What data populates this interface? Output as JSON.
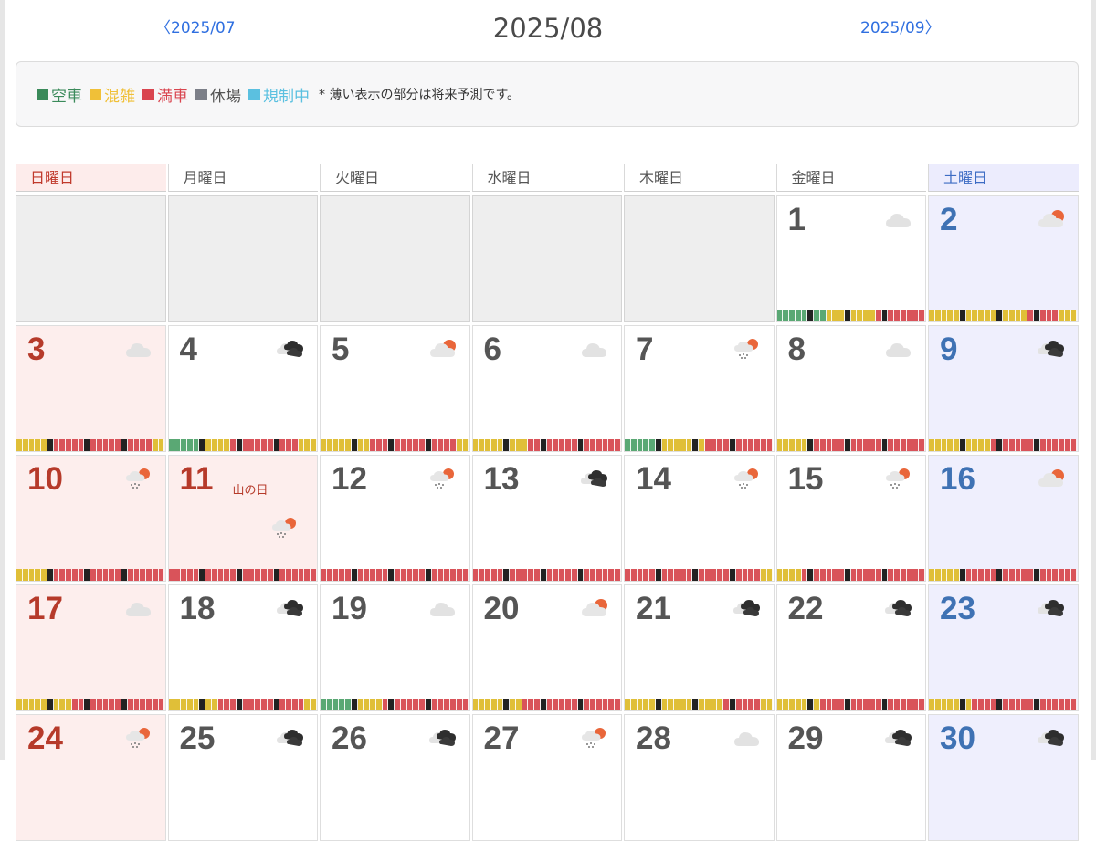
{
  "nav": {
    "prev": "〈2025/07",
    "title": "2025/08",
    "next": "2025/09〉"
  },
  "legend": {
    "items": [
      {
        "label": "空車",
        "color": "#3a8a5a"
      },
      {
        "label": "混雑",
        "color": "#f0c038"
      },
      {
        "label": "満車",
        "color": "#d9454f"
      },
      {
        "label": "休場",
        "color": "#7c7f88"
      },
      {
        "label": "規制中",
        "color": "#5bc0e0"
      }
    ],
    "note": "* 薄い表示の部分は将来予測です。"
  },
  "weekdays": [
    "日曜日",
    "月曜日",
    "火曜日",
    "水曜日",
    "木曜日",
    "金曜日",
    "土曜日"
  ],
  "colors": {
    "empty": "#5aa874",
    "crowded": "#e0bf38",
    "full": "#d9535a",
    "sunday": "#b63a2a",
    "saturday": "#3f72b4"
  },
  "days": [
    {
      "day": "1",
      "col": 5,
      "weather": "cloud",
      "pattern": "GGGGGGGGYYYYYYYYRRRRRRRR"
    },
    {
      "day": "2",
      "col": 6,
      "weather": "sun-cloud",
      "pattern": "YYYYYYYYYYYYYYYYRRRRRYYY"
    },
    {
      "day": "3",
      "col": 0,
      "weather": "cloud",
      "pattern": "YYYYYRRRRRRRRRRRRRRRRRYY"
    },
    {
      "day": "4",
      "col": 1,
      "weather": "dark-cloud",
      "pattern": "GGGGGYYYYYRRRRRRRRRRRYYY"
    },
    {
      "day": "5",
      "col": 2,
      "weather": "sun-cloud",
      "pattern": "YYYYYYYYRRRRRRRRRRRRRRYY"
    },
    {
      "day": "6",
      "col": 3,
      "weather": "cloud",
      "pattern": "YYYYYYYYYRRRRRRRRRRRRRRR"
    },
    {
      "day": "7",
      "col": 4,
      "weather": "rain-sun",
      "pattern": "GGGGGGYYYYYYYRRRRRRRRRRR"
    },
    {
      "day": "8",
      "col": 5,
      "weather": "cloud",
      "pattern": "YYYYYYRRRRRRRRRRRRRRRRRR"
    },
    {
      "day": "9",
      "col": 6,
      "weather": "dark-cloud",
      "pattern": "YYYYYYYYYYRRRRRRRRRRRRRR"
    },
    {
      "day": "10",
      "col": 0,
      "weather": "rain-sun",
      "pattern": "YYYYYYRRRRRRRRRRRRRRRRRR"
    },
    {
      "day": "11",
      "col": 1,
      "weather": "rain-sun",
      "holiday": "山の日",
      "pattern": "RRRRRRRRRRRRRRRRRRRRRRRR"
    },
    {
      "day": "12",
      "col": 2,
      "weather": "rain-sun",
      "pattern": "RRRRRRRRRRRRRRRRRRRRRRRR"
    },
    {
      "day": "13",
      "col": 3,
      "weather": "dark-cloud",
      "pattern": "RRRRRRRRRRRRRRRRRRRRRRRR"
    },
    {
      "day": "14",
      "col": 4,
      "weather": "rain-sun",
      "pattern": "RRRRRRRRRRRRRRRRRRRRRRYY"
    },
    {
      "day": "15",
      "col": 5,
      "weather": "rain-sun",
      "pattern": "YYYYRRRRRRRRRRRRRRRRRRRR"
    },
    {
      "day": "16",
      "col": 6,
      "weather": "sun-cloud",
      "pattern": "YYYYYYRRRRRRRRRRRRRRRRRR"
    },
    {
      "day": "17",
      "col": 0,
      "weather": "cloud",
      "pattern": "YYYYYYYYYRRRRRRRRRRRRRRR"
    },
    {
      "day": "18",
      "col": 1,
      "weather": "dark-cloud",
      "pattern": "YYYYYYYYRRRRRRRRRRRRRRYY"
    },
    {
      "day": "19",
      "col": 2,
      "weather": "cloud",
      "pattern": "GGGGGGYYYYRRRRRRRRRRRRRR"
    },
    {
      "day": "20",
      "col": 3,
      "weather": "sun-cloud",
      "pattern": "YYYYYYYYRRRRRRRRRRRRRRRR"
    },
    {
      "day": "21",
      "col": 4,
      "weather": "dark-cloud",
      "pattern": "YYYYYYYYYYYYYYYYRRRRRRYY"
    },
    {
      "day": "22",
      "col": 5,
      "weather": "dark-cloud",
      "pattern": "YYYYYYYRRRRRRRRRRRRRRRRR"
    },
    {
      "day": "23",
      "col": 6,
      "weather": "dark-cloud",
      "pattern": "YYYYYYYRRRRRRRRRRRRRRRRR"
    },
    {
      "day": "24",
      "col": 0,
      "weather": "rain-sun",
      "pattern": ""
    },
    {
      "day": "25",
      "col": 1,
      "weather": "dark-cloud",
      "pattern": ""
    },
    {
      "day": "26",
      "col": 2,
      "weather": "dark-cloud",
      "pattern": ""
    },
    {
      "day": "27",
      "col": 3,
      "weather": "rain-sun",
      "pattern": ""
    },
    {
      "day": "28",
      "col": 4,
      "weather": "cloud",
      "pattern": ""
    },
    {
      "day": "29",
      "col": 5,
      "weather": "dark-cloud",
      "pattern": ""
    },
    {
      "day": "30",
      "col": 6,
      "weather": "dark-cloud",
      "pattern": ""
    }
  ]
}
